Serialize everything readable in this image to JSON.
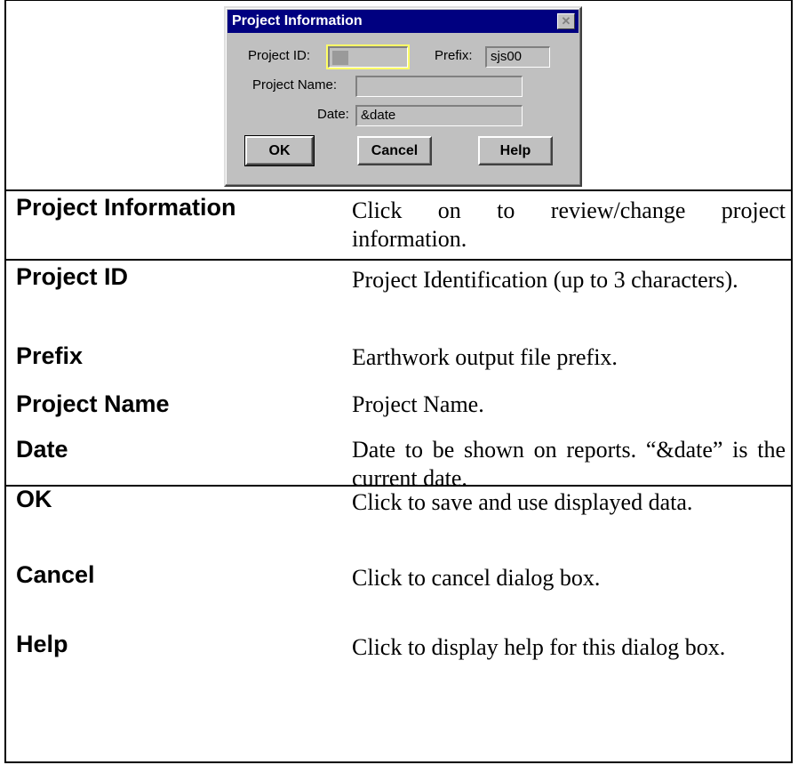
{
  "dialog": {
    "title": "Project Information",
    "close_glyph": "✕",
    "project_id_label": "Project ID:",
    "project_id_value": "",
    "prefix_label": "Prefix:",
    "prefix_value": "sjs00",
    "project_name_label": "Project Name:",
    "project_name_value": "",
    "date_label": "Date:",
    "date_value": "&date",
    "ok_label": "OK",
    "cancel_label": "Cancel",
    "help_label": "Help"
  },
  "rows": [
    {
      "term": "Project Information",
      "desc": "Click on to review/change project information."
    },
    {
      "term": "Project ID",
      "desc": "Project Identification (up to 3 characters)."
    },
    {
      "term": "Prefix",
      "desc": "Earthwork output file prefix."
    },
    {
      "term": "Project Name",
      "desc": "Project Name."
    },
    {
      "term": "Date",
      "desc": "Date to be shown on reports. “&date” is the current date."
    },
    {
      "term": "OK",
      "desc": "Click to save and use displayed data."
    },
    {
      "term": "Cancel",
      "desc": "Click to cancel dialog box."
    },
    {
      "term": "Help",
      "desc": "Click to display help for this dialog box."
    }
  ],
  "colors": {
    "titlebar": "#000080",
    "dialog_face": "#c0c0c0",
    "focus_outline": "#ffff66"
  }
}
